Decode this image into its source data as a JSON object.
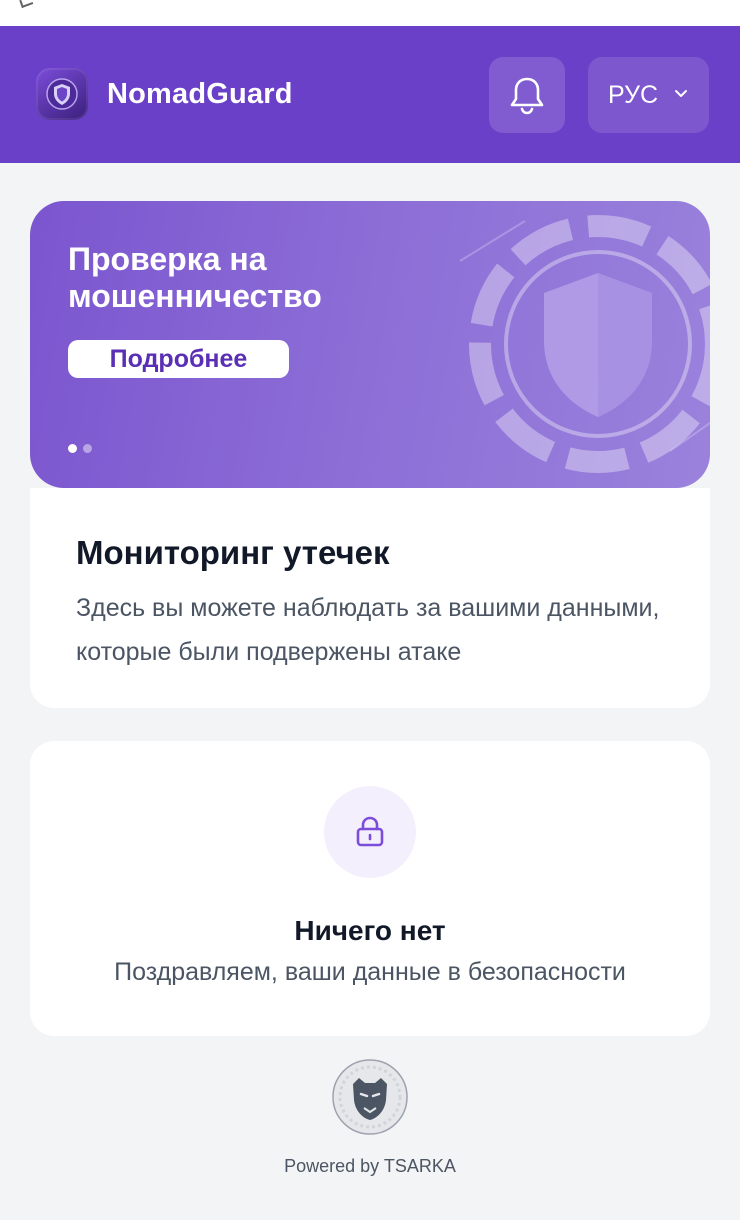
{
  "header": {
    "app_title": "NomadGuard",
    "language_label": "РУС"
  },
  "banner": {
    "title": "Проверка на мошенничество",
    "button_label": "Подробнее",
    "slides_total": 2,
    "active_slide": 1
  },
  "monitoring": {
    "title": "Мониторинг утечек",
    "description": "Здесь вы можете наблюдать за вашими данными, которые были подвержены атаке"
  },
  "empty_state": {
    "title": "Ничего нет",
    "description": "Поздравляем, ваши данные в безопасности"
  },
  "footer": {
    "powered_by": "Powered by TSARKA"
  },
  "colors": {
    "header_bg": "#6a40c8",
    "accent": "#5b2fb5",
    "page_bg": "#f3f4f6"
  },
  "icons": [
    "shield-logo-icon",
    "bell-icon",
    "chevron-down-icon",
    "shield-graphic-icon",
    "lock-icon",
    "tsarka-logo-icon"
  ]
}
